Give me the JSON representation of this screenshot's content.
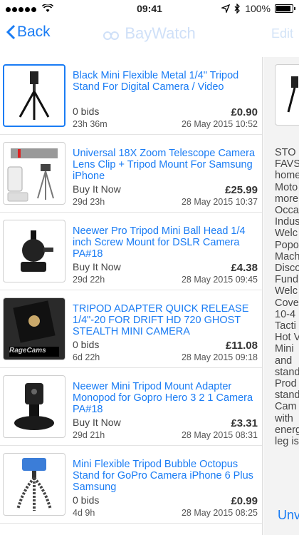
{
  "status": {
    "time": "09:41",
    "battery": "100%"
  },
  "nav": {
    "back_label": "Back",
    "title": "BayWatch",
    "edit_label": "Edit"
  },
  "items": [
    {
      "title": "Black Mini Flexible Metal 1/4\" Tripod Stand For Digital Camera / Video",
      "left1": "0 bids",
      "left2": "23h 36m",
      "price": "£0.90",
      "date": "26 May 2015 10:52"
    },
    {
      "title": "Universal 18X Zoom Telescope Camera Lens Clip + Tripod Mount For Samsung iPhone",
      "left1": "Buy It Now",
      "left2": "29d 23h",
      "price": "£25.99",
      "date": "28 May 2015 10:37"
    },
    {
      "title": "Neewer Pro Tripod Mini Ball Head 1/4 inch Screw Mount for DSLR Camera PA#18",
      "left1": "Buy It Now",
      "left2": "29d 22h",
      "price": "£4.38",
      "date": "28 May 2015 09:45"
    },
    {
      "title": "TRIPOD ADAPTER QUICK RELEASE 1/4\"-20 FOR DRIFT HD 720 GHOST STEALTH MINI CAMERA",
      "left1": "0 bids",
      "left2": "6d 22h",
      "price": "£11.08",
      "date": "28 May 2015 09:18"
    },
    {
      "title": "Neewer Mini Tripod Mount Adapter Monopod for Gopro Hero 3 2 1 Camera PA#18",
      "left1": "Buy It Now",
      "left2": "29d 21h",
      "price": "£3.31",
      "date": "28 May 2015 08:31"
    },
    {
      "title": "Mini Flexible Tripod Bubble Octopus Stand for GoPro Camera iPhone 6 Plus Samsung",
      "left1": "0 bids",
      "left2": "4d 9h",
      "price": "£0.99",
      "date": "28 May 2015 08:25"
    }
  ],
  "detail": {
    "description": "STO\nFAVS\nhome\nMoto\nmore\nOcca\nIndus\nWelc\nPopo\nMach\nDisco\nFund\nWelc\nCove\n10-4\nTacti\nHot V\nMini\nand\nstand\nProd\nstand\nCam\nwith\nenerg\nleg is",
    "button_label": "Unv"
  },
  "colors": {
    "accent": "#1a7cf4"
  }
}
